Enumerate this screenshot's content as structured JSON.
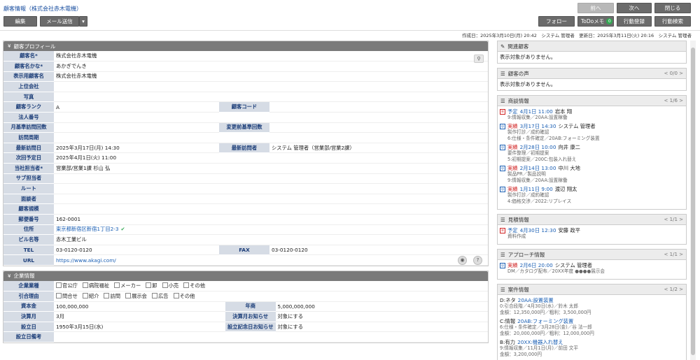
{
  "header": {
    "title": "顧客情報（株式会社赤木電機）",
    "edit": "編集",
    "mail": "メール送信",
    "follow": "フォロー",
    "todo": "ToDoメモ",
    "todo_badge": "0",
    "act_reg": "行動登録",
    "act_search": "行動検索",
    "prev": "前へ",
    "next": "次へ",
    "close": "閉じる"
  },
  "meta": "作成日：2025年3月10日(月) 20:42　システム 管理者　更新日：2025年3月11日(火) 20:16　システム 管理者",
  "profile": {
    "title": "顧客プロフィール",
    "rows": [
      {
        "l": "顧客名*",
        "v": "株式会社赤木電機"
      },
      {
        "l": "顧客名かな*",
        "v": "あかぎでんき"
      },
      {
        "l": "表示用顧客名",
        "v": "株式会社赤木電機"
      },
      {
        "l": "上位会社",
        "v": ""
      },
      {
        "l": "写真",
        "v": ""
      },
      {
        "l": "顧客ランク",
        "v": "A",
        "l2": "顧客コード",
        "v2": ""
      },
      {
        "l": "法人番号",
        "v": ""
      },
      {
        "l": "月基準訪問回数",
        "v": "",
        "l2": "変更前基準回数",
        "v2": ""
      },
      {
        "l": "訪問周期",
        "v": ""
      },
      {
        "l": "最新訪問日",
        "v": "2025年3月17日(月) 14:30",
        "l2": "最新訪問者",
        "v2": "システム 管理者（営業部/営業2課）"
      },
      {
        "l": "次回予定日",
        "v": "2025年4月1日(火) 11:00"
      },
      {
        "l": "当社担当者*",
        "v": "営業部/営業1課 杉山 弘"
      },
      {
        "l": "サブ担当者",
        "v": ""
      },
      {
        "l": "ルート",
        "v": ""
      },
      {
        "l": "面談者",
        "v": ""
      },
      {
        "l": "顧客規模",
        "v": ""
      },
      {
        "l": "郵便番号",
        "v": "162-0001"
      },
      {
        "l": "住所",
        "v": "東京都新宿区新宿1丁目2-3"
      },
      {
        "l": "ビル名等",
        "v": "赤木工業ビル"
      },
      {
        "l": "TEL",
        "v": "03-0120-0120",
        "l2": "FAX",
        "v2": "03-0120-0120"
      },
      {
        "l": "URL",
        "v": "https://www.akagi.com/"
      }
    ]
  },
  "company": {
    "title": "企業情報",
    "type_label": "企業業種",
    "type_opts": [
      "官公庁",
      "病院福祉",
      "メーカー",
      "卸",
      "小売",
      "その他"
    ],
    "trigger_label": "引合理由",
    "trigger_opts": [
      "問合せ",
      "紹介",
      "訪問",
      "展示会",
      "広告",
      "その他"
    ],
    "rows": [
      {
        "l": "資本金",
        "v": "100,000,000",
        "l2": "年商",
        "v2": "5,000,000,000"
      },
      {
        "l": "決算月",
        "v": "3月",
        "l2": "決算月お知らせ",
        "v2": "対象にする"
      },
      {
        "l": "設立日",
        "v": "1950年3月15日(水)",
        "l2": "設立記念日お知らせ",
        "v2": "対象にする"
      },
      {
        "l": "設立日備考",
        "v": ""
      }
    ]
  },
  "panels": {
    "related": {
      "title": "関連顧客",
      "empty": "表示対象がありません。"
    },
    "voice": {
      "title": "顧客の声",
      "nav": "0/0",
      "empty": "表示対象がありません。"
    },
    "history": {
      "title": "商談情報",
      "nav": "1/6",
      "items": [
        {
          "k": "予定",
          "date": "4月1日 11:00",
          "who": "岩本 翔",
          "sub": "9:情報収集／20AA:設置稼働"
        },
        {
          "k": "実績",
          "date": "3月17日 14:30",
          "who": "システム 管理者",
          "sub": "製作打診／成約確認",
          "sub2": "6:仕様・条件確定／20AB:フォーミング装置"
        },
        {
          "k": "実績",
          "date": "2月28日 10:00",
          "who": "向井 康二",
          "sub": "要件整理／初期提案",
          "sub2": "5:初期提案／200C:包装入れ替え"
        },
        {
          "k": "実績",
          "date": "2月14日 13:00",
          "who": "中川 大地",
          "sub": "製品PR／製品説明",
          "sub2": "9:情報収集／20AA:設置稼働"
        },
        {
          "k": "実績",
          "date": "1月11日 9:00",
          "who": "渡辺 翔太",
          "sub": "製作打診／成約確認",
          "sub2": "4:価格交渉／2022:リプレイス"
        }
      ]
    },
    "quote": {
      "title": "見積情報",
      "nav": "1/1",
      "items": [
        {
          "k": "予定",
          "date": "4月30日 12:30",
          "who": "安藤 政平",
          "sub": "資料作成"
        }
      ]
    },
    "approach": {
      "title": "アプローチ情報",
      "nav": "1/1",
      "items": [
        {
          "k": "実績",
          "date": "2月6日 20:00",
          "who": "システム 管理者",
          "sub": "DM／カタログ配布／20XX年度 ●●●●展示会"
        }
      ]
    },
    "deals": {
      "title": "案件情報",
      "nav": "1/2",
      "items": [
        {
          "k": "D:ネタ",
          "name": "20AA:設置装置",
          "sub": "0:引合段階／4月30日(水)／鈴木 太郎",
          "sub2": "金額：12,350,000円／粗利：3,500,000円"
        },
        {
          "k": "C:情報",
          "name": "20AB:フォーミング装置",
          "sub": "6:仕様・条件確定／3月28日(金)／谷 法一郎",
          "sub2": "金額：20,000,000円／粗利：12,000,000円"
        },
        {
          "k": "B:有力",
          "name": "20XX:機器入れ替え",
          "sub": "9:情報収集／11月1日(月)／前田 文平",
          "sub2": "金額：3,200,000円"
        }
      ]
    }
  }
}
